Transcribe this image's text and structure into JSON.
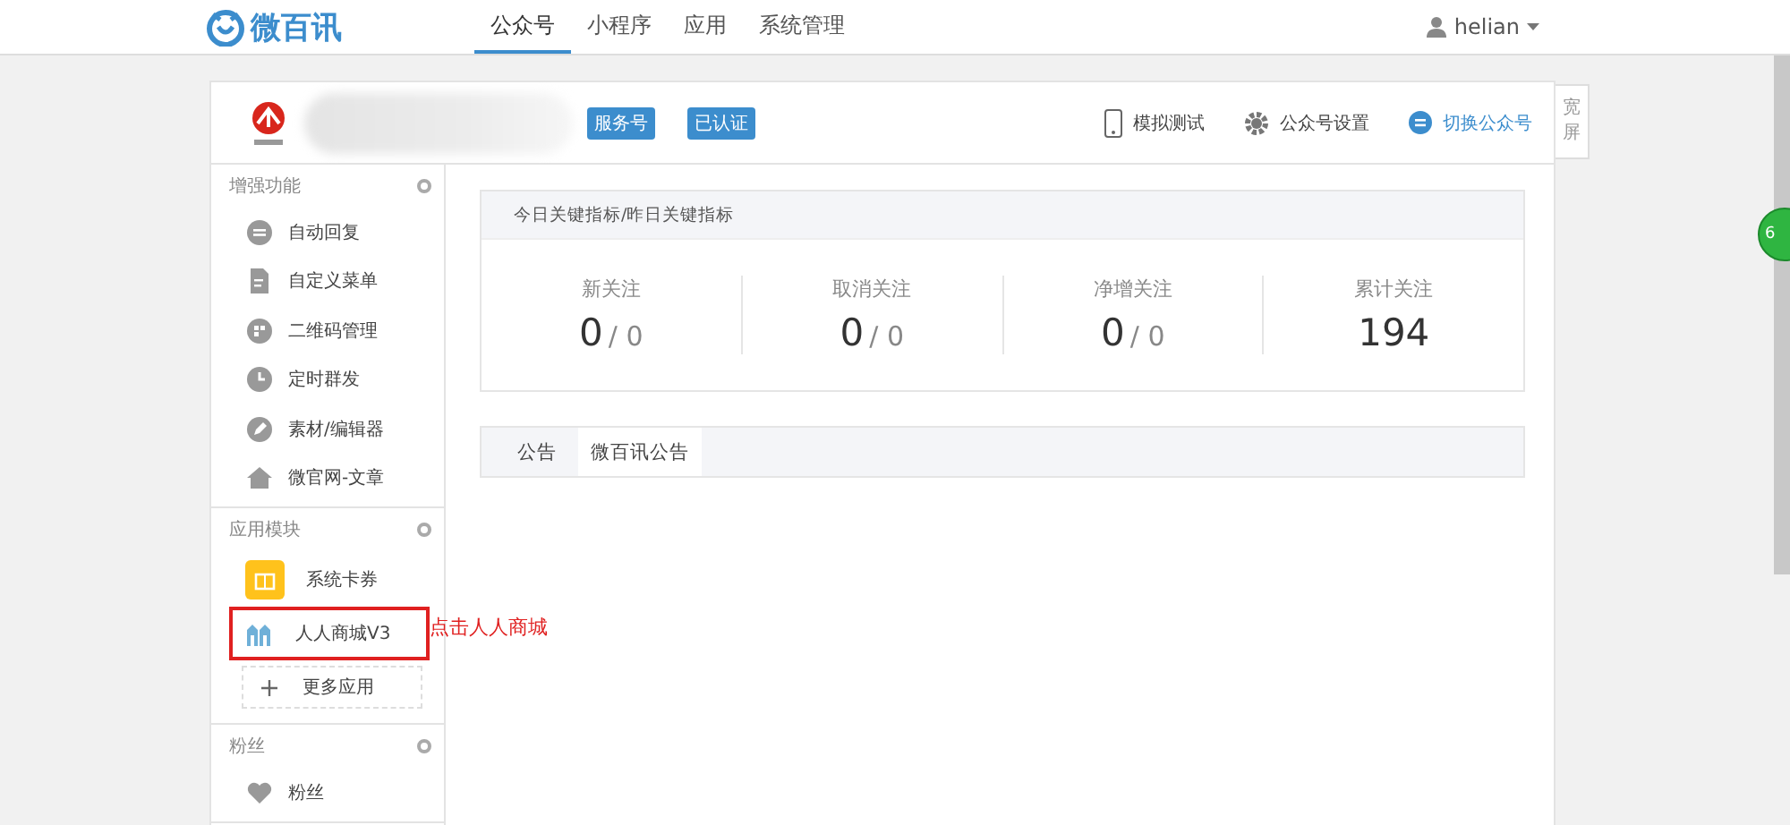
{
  "brand": {
    "name": "微百讯"
  },
  "nav": [
    {
      "label": "公众号",
      "selected": true
    },
    {
      "label": "小程序",
      "selected": false
    },
    {
      "label": "应用",
      "selected": false
    },
    {
      "label": "系统管理",
      "selected": false
    }
  ],
  "user": {
    "name": "helian"
  },
  "account": {
    "badges": [
      "服务号",
      "已认证"
    ],
    "actions": [
      {
        "kind": "phone",
        "label": "模拟测试"
      },
      {
        "kind": "gear",
        "label": "公众号设置"
      },
      {
        "kind": "switch",
        "label": "切换公众号"
      }
    ]
  },
  "wide_toggle": {
    "label": "宽屏"
  },
  "sidebar": {
    "sections": [
      {
        "title": "增强功能",
        "items": [
          {
            "kind": "chat",
            "label": "自动回复",
            "annotated": false
          },
          {
            "kind": "doc",
            "label": "自定义菜单",
            "annotated": false
          },
          {
            "kind": "qr",
            "label": "二维码管理",
            "annotated": false
          },
          {
            "kind": "clock",
            "label": "定时群发",
            "annotated": false
          },
          {
            "kind": "pen",
            "label": "素材/编辑器",
            "annotated": false
          },
          {
            "kind": "home",
            "label": "微官网-文章",
            "annotated": false
          }
        ]
      },
      {
        "title": "应用模块",
        "items": [
          {
            "kind": "coupon",
            "label": "系统卡券",
            "annotated": false
          },
          {
            "kind": "shop",
            "label": "人人商城V3",
            "annotated": true
          }
        ],
        "more": "更多应用"
      },
      {
        "title": "粉丝",
        "items": [
          {
            "kind": "heart",
            "label": "粉丝",
            "annotated": false
          }
        ]
      }
    ]
  },
  "annotation": {
    "text": "点击人人商城"
  },
  "stats": {
    "title": "今日关键指标/昨日关键指标",
    "items": [
      {
        "kind": "pair",
        "label": "新关注",
        "today": "0",
        "yesterday": "/ 0"
      },
      {
        "kind": "pair",
        "label": "取消关注",
        "today": "0",
        "yesterday": "/ 0"
      },
      {
        "kind": "pair",
        "label": "净增关注",
        "today": "0",
        "yesterday": "/ 0"
      },
      {
        "kind": "total",
        "label": "累计关注",
        "today": "194"
      }
    ]
  },
  "notice_tabs": [
    {
      "label": "公告",
      "selected": false
    },
    {
      "label": "微百讯公告",
      "selected": true
    }
  ],
  "float_badge": {
    "text": "6"
  }
}
